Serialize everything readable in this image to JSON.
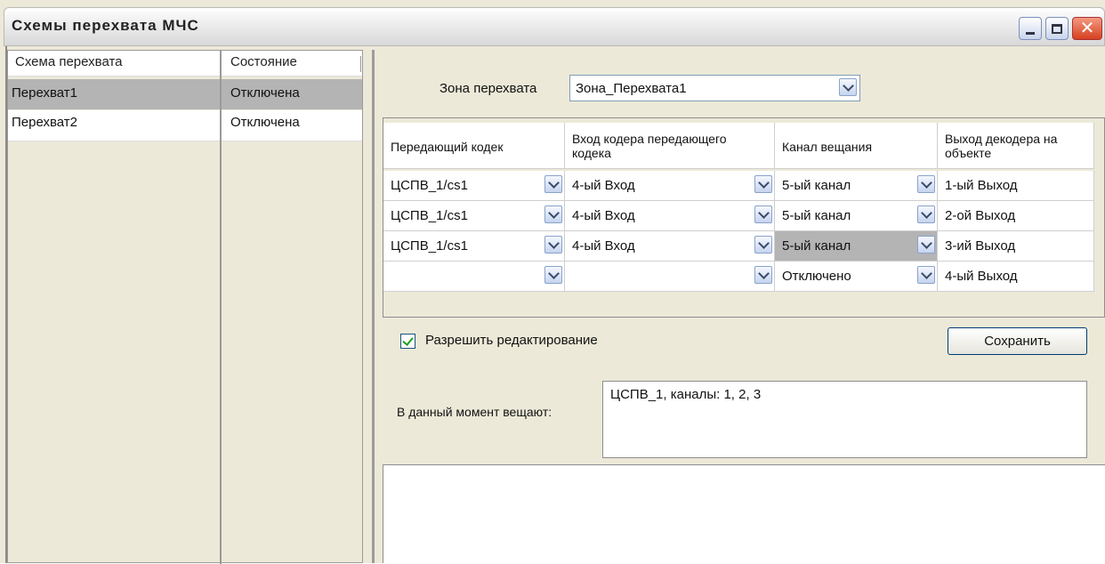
{
  "window": {
    "title": "Схемы перехвата МЧС"
  },
  "schemes_list": {
    "columns": [
      "Схема перехвата",
      "Состояние"
    ],
    "rows": [
      {
        "name": "Перехват1",
        "state": "Отключена",
        "selected": true
      },
      {
        "name": "Перехват2",
        "state": "Отключена",
        "selected": false
      }
    ]
  },
  "zone": {
    "label": "Зона перехвата",
    "value": "Зона_Перехвата1"
  },
  "grid": {
    "columns": [
      "Передающий кодек",
      "Вход кодера передающего кодека",
      "Канал вещания",
      "Выход декодера на объекте"
    ],
    "rows": [
      {
        "codec": "ЦСПВ_1/cs1",
        "input": "4-ый Вход",
        "channel": "5-ый канал",
        "output": "1-ый Выход"
      },
      {
        "codec": "ЦСПВ_1/cs1",
        "input": "4-ый Вход",
        "channel": "5-ый канал",
        "output": "2-ой Выход"
      },
      {
        "codec": "ЦСПВ_1/cs1",
        "input": "4-ый Вход",
        "channel": "5-ый канал",
        "output": "3-ий Выход"
      },
      {
        "codec": "",
        "input": "",
        "channel": "Отключено",
        "output": "4-ый Выход"
      }
    ]
  },
  "edit": {
    "label": "Разрешить редактирование",
    "checked": true
  },
  "save_button": "Сохранить",
  "now_broadcasting": {
    "label": "В данный момент вещают:",
    "value": "ЦСПВ_1, каналы: 1, 2, 3"
  },
  "colors": {
    "selection": "#b4b4b4",
    "window_bg": "#ece9d8",
    "check": "#21a121"
  }
}
